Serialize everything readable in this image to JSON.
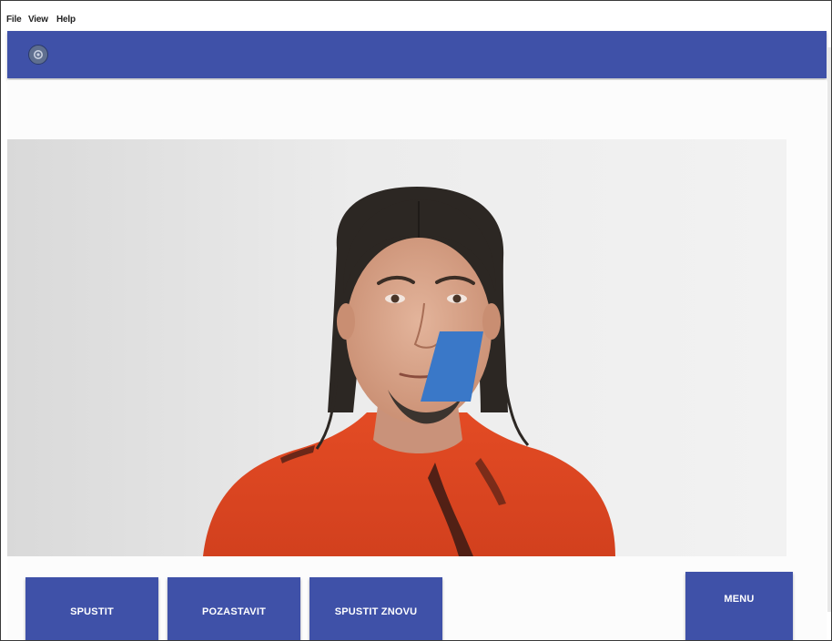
{
  "menubar": {
    "items": [
      {
        "label": "File"
      },
      {
        "label": "View"
      },
      {
        "label": "Help"
      }
    ]
  },
  "appbar": {
    "icon": "settings-icon",
    "color": "#3f51a8"
  },
  "controls": {
    "start_label": "SPUSTIT",
    "pause_label": "POZASTAVIT",
    "restart_label": "SPUSTIT ZNOVU",
    "menu_label": "MENU"
  },
  "overlay": {
    "marker_color": "#3a78c8"
  }
}
